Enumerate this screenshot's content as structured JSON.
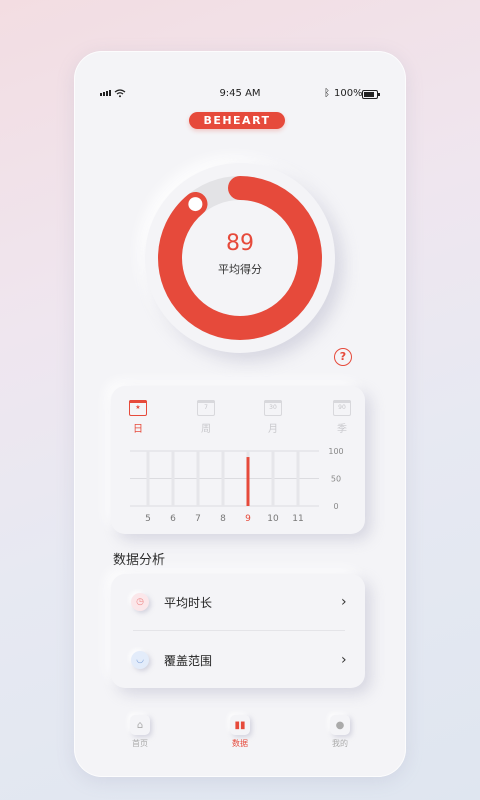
{
  "status": {
    "time": "9:45 AM",
    "battery": "100%"
  },
  "brand": {
    "logo": "BEHEART",
    "accent": "#e64a3b"
  },
  "score": {
    "value": "89",
    "label": "平均得分",
    "fraction": 0.89
  },
  "tabs": [
    {
      "label": "日",
      "icon_num": "",
      "icon": "calendar-day-icon",
      "active": true
    },
    {
      "label": "周",
      "icon_num": "7",
      "icon": "calendar-week-icon",
      "active": false
    },
    {
      "label": "月",
      "icon_num": "30",
      "icon": "calendar-month-icon",
      "active": false
    },
    {
      "label": "季",
      "icon_num": "90",
      "icon": "calendar-quarter-icon",
      "active": false
    }
  ],
  "chart_data": {
    "type": "bar",
    "categories": [
      "5",
      "6",
      "7",
      "8",
      "9",
      "10",
      "11"
    ],
    "values": [
      0,
      0,
      0,
      0,
      89,
      0,
      0
    ],
    "highlight": "9",
    "yticks": [
      "100",
      "50",
      "0"
    ],
    "ylim": [
      0,
      100
    ],
    "grid": true
  },
  "analysis": {
    "title": "数据分析",
    "rows": [
      {
        "label": "平均时长",
        "icon": "clock-icon"
      },
      {
        "label": "覆盖范围",
        "icon": "tooth-icon"
      }
    ]
  },
  "nav": [
    {
      "label": "首页",
      "icon": "home-icon",
      "active": false
    },
    {
      "label": "数据",
      "icon": "bar-chart-icon",
      "active": true
    },
    {
      "label": "我的",
      "icon": "user-icon",
      "active": false
    }
  ]
}
